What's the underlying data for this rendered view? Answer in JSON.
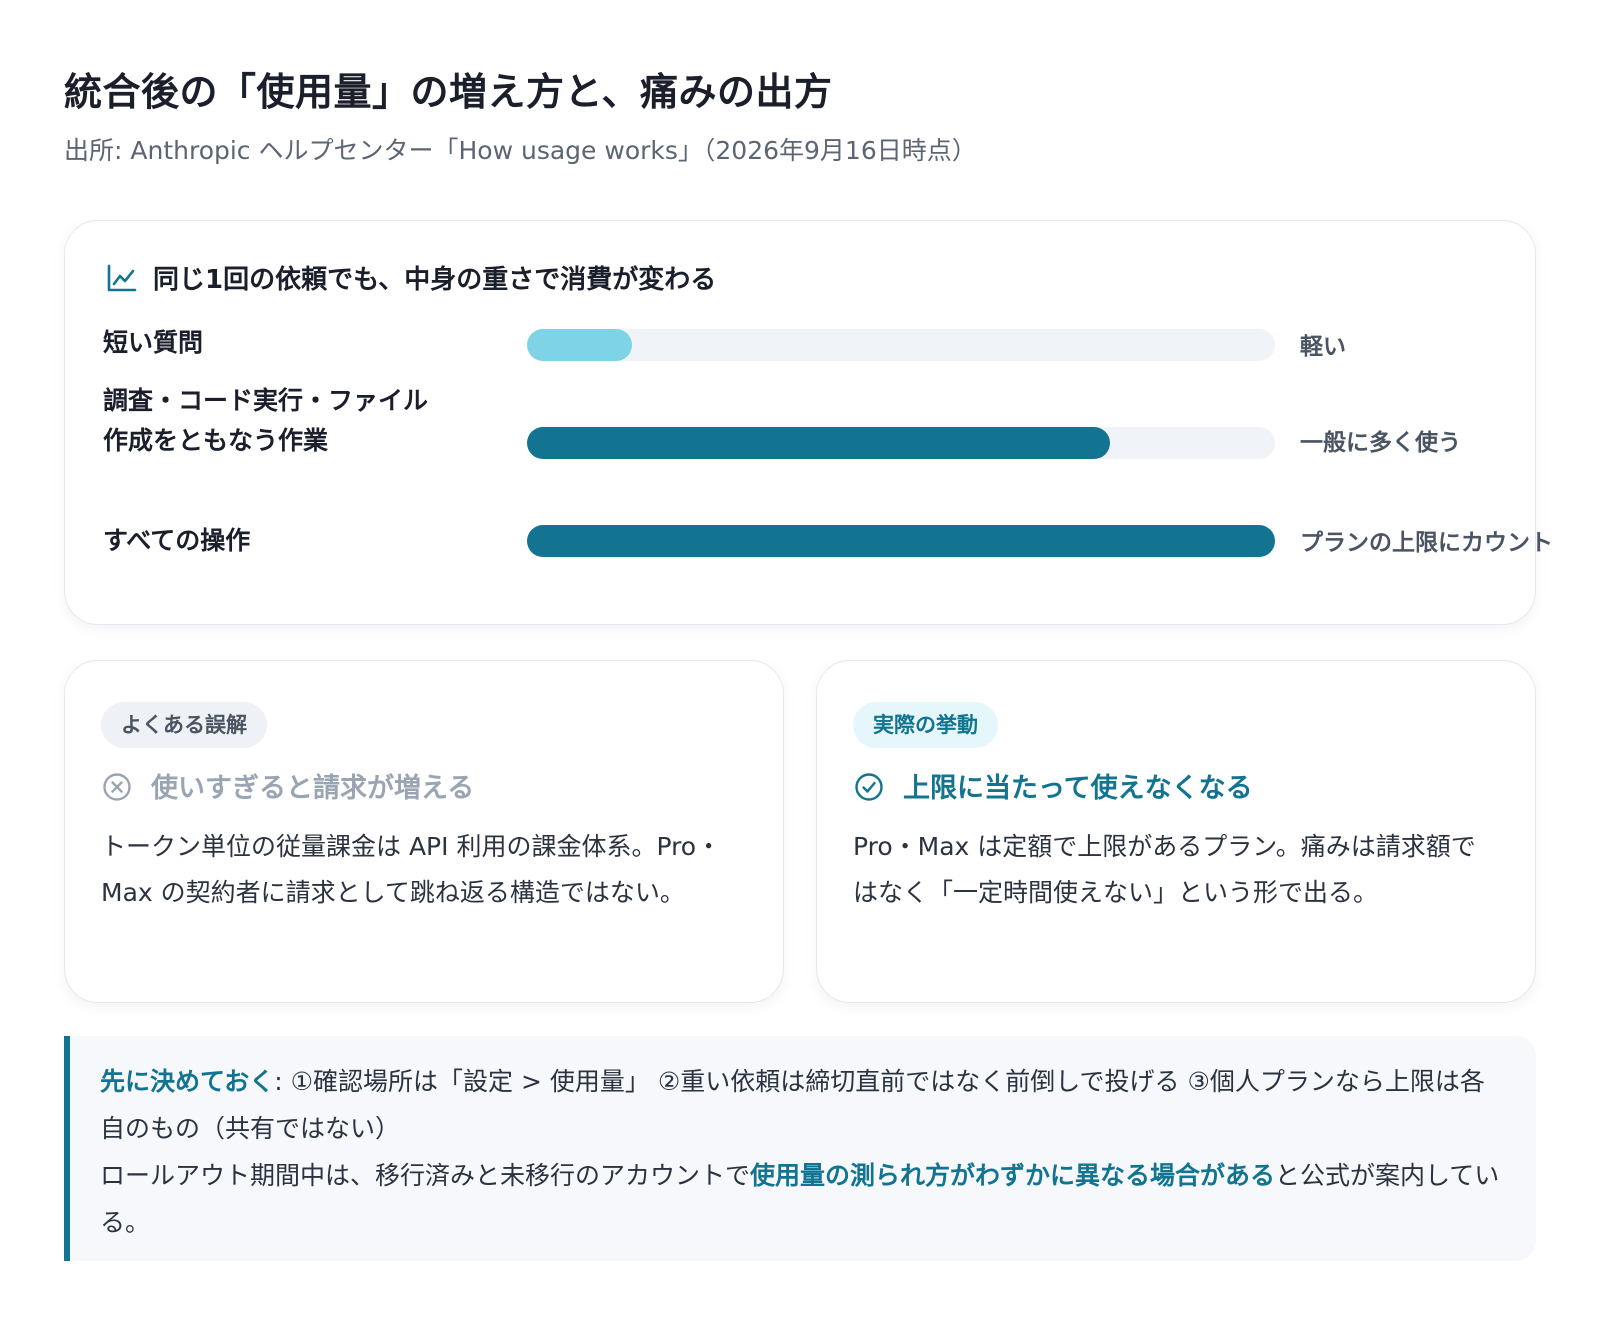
{
  "page": {
    "title": "統合後の「使用量」の増え方と、痛みの出方",
    "source": "出所: Anthropic ヘルプセンター「How usage works」（2026年9月16日時点）"
  },
  "usage_chart": {
    "title": "同じ1回の依頼でも、中身の重さで消費が変わる",
    "icon": "line-chart-icon",
    "rows": [
      {
        "label": "短い質問",
        "level": 0.14,
        "note": "軽い",
        "color": "#7ed3e6"
      },
      {
        "label": "調査・コード実行・ファイル作成をともなう作業",
        "level": 0.78,
        "note": "一般に多く使う",
        "color": "#127490"
      },
      {
        "label": "すべての操作",
        "level": 1.0,
        "note": "プランの上限にカウント",
        "color": "#127490"
      }
    ]
  },
  "misconception_card": {
    "badge": "よくある誤解",
    "icon": "x-circle-icon",
    "heading": "使いすぎると請求が増える",
    "body": "トークン単位の従量課金は API 利用の課金体系。Pro・Max の契約者に請求として跳ね返る構造ではない。",
    "accent": "#9aa5b4"
  },
  "actual_card": {
    "badge": "実際の挙動",
    "icon": "check-circle-icon",
    "heading": "上限に当たって使えなくなる",
    "body": "Pro・Max は定額で上限があるプラン。痛みは請求額ではなく「一定時間使えない」という形で出る。",
    "accent": "#127490"
  },
  "callout": {
    "lead": "先に決めておく",
    "line1": ": ①確認場所は「設定 > 使用量」 ②重い依頼は締切直前ではなく前倒しで投げる ③個人プランなら上限は各自のもの（共有ではない）",
    "line2_prefix": "ロールアウト期間中は、移行済みと未移行のアカウントで",
    "line2_highlight": "使用量の測られ方がわずかに異なる場合がある",
    "line2_suffix": "と公式が案内している。"
  }
}
